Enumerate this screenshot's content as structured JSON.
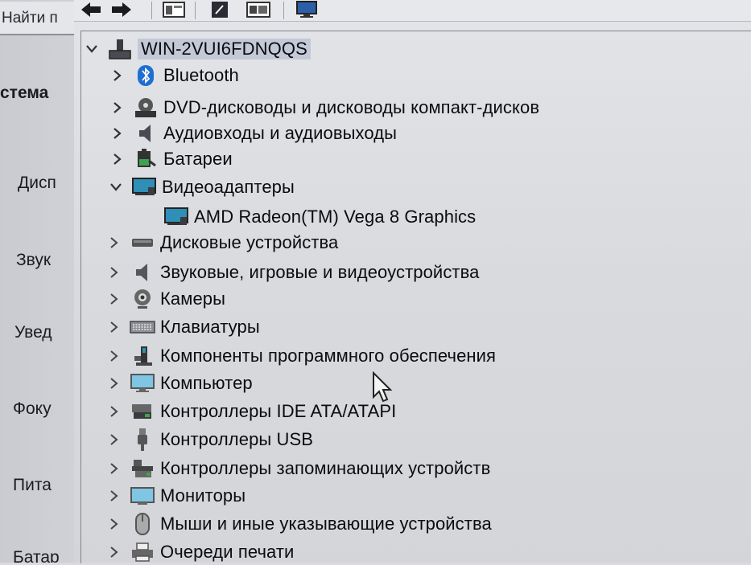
{
  "settings": {
    "search_text": "Найти п",
    "heading": "стема",
    "items": [
      "Дисп",
      "Звук",
      "Увед",
      "Фоку",
      "Пита",
      "Батар"
    ]
  },
  "toolbar": {
    "icons": [
      "back-arrow-icon",
      "forward-arrow-icon",
      "show-hide-tree-icon",
      "properties-icon",
      "update-driver-icon",
      "scan-hardware-icon"
    ]
  },
  "tree": {
    "root": "WIN-2VUI6FDNQQS",
    "categories": [
      {
        "label": "Bluetooth",
        "icon": "bluetooth-icon",
        "expanded": false
      },
      {
        "label": "DVD-дисководы и дисководы компакт-дисков",
        "icon": "dvd-drive-icon",
        "expanded": false
      },
      {
        "label": "Аудиовходы и аудиовыходы",
        "icon": "speaker-icon",
        "expanded": false
      },
      {
        "label": "Батареи",
        "icon": "battery-icon",
        "expanded": false
      },
      {
        "label": "Видеоадаптеры",
        "icon": "display-adapter-icon",
        "expanded": true
      },
      {
        "label": "AMD Radeon(TM) Vega 8 Graphics",
        "icon": "display-adapter-icon",
        "child": true
      },
      {
        "label": "Дисковые устройства",
        "icon": "disk-drive-icon",
        "expanded": false
      },
      {
        "label": "Звуковые, игровые и видеоустройства",
        "icon": "speaker-icon",
        "expanded": false
      },
      {
        "label": "Камеры",
        "icon": "camera-icon",
        "expanded": false
      },
      {
        "label": "Клавиатуры",
        "icon": "keyboard-icon",
        "expanded": false
      },
      {
        "label": "Компоненты программного обеспечения",
        "icon": "software-component-icon",
        "expanded": false
      },
      {
        "label": "Компьютер",
        "icon": "computer-icon",
        "expanded": false
      },
      {
        "label": "Контроллеры IDE ATA/ATAPI",
        "icon": "ide-controller-icon",
        "expanded": false
      },
      {
        "label": "Контроллеры USB",
        "icon": "usb-icon",
        "expanded": false
      },
      {
        "label": "Контроллеры запоминающих устройств",
        "icon": "storage-controller-icon",
        "expanded": false
      },
      {
        "label": "Мониторы",
        "icon": "monitor-icon",
        "expanded": false
      },
      {
        "label": "Мыши и иные указывающие устройства",
        "icon": "mouse-icon",
        "expanded": false
      },
      {
        "label": "Очереди печати",
        "icon": "printer-icon",
        "expanded": false
      }
    ]
  },
  "colors": {
    "selection": "#c3c9d6",
    "icon_blue": "#1f6fd0",
    "screen_teal": "#2f8fb6"
  }
}
